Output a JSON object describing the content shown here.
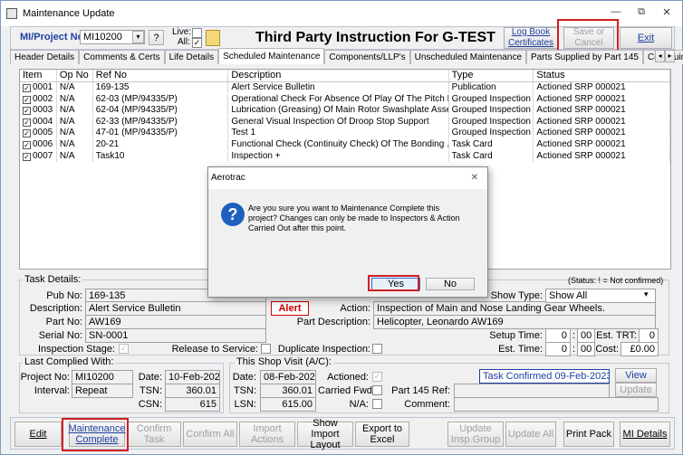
{
  "window": {
    "title": "Maintenance Update",
    "min": "—",
    "restore": "⧉",
    "close": "✕"
  },
  "top": {
    "project_label": "MI/Project No:",
    "project_value": "MI10200",
    "help": "?",
    "live_label": "Live:",
    "all_label": "All:",
    "instruction_title": "Third Party Instruction For G-TEST",
    "logbook": "Log Book Certificates",
    "save_cancel": "Save or Cancel",
    "exit": "Exit"
  },
  "tabs": [
    "Header Details",
    "Comments & Certs",
    "Life Details",
    "Scheduled Maintenance",
    "Components/LLP's",
    "Unscheduled Maintenance",
    "Parts Supplied by Part 145",
    "Continuing Airworthiness"
  ],
  "tab_arrows": {
    "left": "◂",
    "right": "▸"
  },
  "grid": {
    "headers": [
      "Item",
      "Op No",
      "Ref No",
      "Description",
      "Type",
      "Status"
    ],
    "rows": [
      {
        "item": "0001",
        "op": "N/A",
        "ref": "169-135",
        "desc": "Alert Service Bulletin",
        "type": "Publication",
        "status": "Actioned SRP 000021"
      },
      {
        "item": "0002",
        "op": "N/A",
        "ref": "62-03 (MP/94335/P)",
        "desc": "Operational Check For Absence Of Play Of The Pitch Li...",
        "type": "Grouped Inspection",
        "status": "Actioned SRP 000021"
      },
      {
        "item": "0003",
        "op": "N/A",
        "ref": "62-04 (MP/94335/P)",
        "desc": "Lubrication (Greasing) Of Main Rotor Swashplate Asse...",
        "type": "Grouped Inspection",
        "status": "Actioned SRP 000021"
      },
      {
        "item": "0004",
        "op": "N/A",
        "ref": "62-33 (MP/94335/P)",
        "desc": "General Visual Inspection Of Droop Stop Support",
        "type": "Grouped Inspection",
        "status": "Actioned SRP 000021"
      },
      {
        "item": "0005",
        "op": "N/A",
        "ref": "47-01 (MP/94335/P)",
        "desc": "Test 1",
        "type": "Grouped Inspection",
        "status": "Actioned SRP 000021"
      },
      {
        "item": "0006",
        "op": "N/A",
        "ref": "20-21",
        "desc": "Functional Check (Continuity Check)  Of The Bonding ...",
        "type": "Task Card",
        "status": "Actioned SRP 000021"
      },
      {
        "item": "0007",
        "op": "N/A",
        "ref": "Task10",
        "desc": "Inspection +",
        "type": "Task Card",
        "status": "Actioned SRP 000021"
      }
    ]
  },
  "task": {
    "title": "Task Details:",
    "status_note": "(Status: ! = Not confirmed)",
    "pub_label": "Pub No:",
    "pub": "169-135",
    "desc_label": "Description:",
    "desc": "Alert Service Bulletin",
    "alert": "Alert",
    "action_label": "Action:",
    "action": "Inspection of Main and Nose Landing Gear Wheels.",
    "show_type_label": "Show Type:",
    "show_type": "Show All",
    "part_label": "Part No:",
    "part": "AW169",
    "part_desc_label": "Part Description:",
    "part_desc": "Helicopter, Leonardo AW169",
    "serial_label": "Serial No:",
    "serial": "SN-0001",
    "setup_label": "Setup Time:",
    "setup_h": "0",
    "setup_m": "00",
    "est_trt_label": "Est. TRT:",
    "est_trt": "0",
    "insp_stage_label": "Inspection Stage:",
    "rel_service_label": "Release to Service:",
    "dup_insp_label": "Duplicate Inspection:",
    "est_time_label": "Est. Time:",
    "est_h": "0",
    "est_m": "00",
    "cost_label": "Cost:",
    "cost": "£0.00"
  },
  "last": {
    "title": "Last Complied With:",
    "project_label": "Project No:",
    "project": "MI10200",
    "date_label": "Date:",
    "date": "10-Feb-2023",
    "interval_label": "Interval:",
    "interval": "Repeat",
    "tsn_label": "TSN:",
    "tsn": "360.01",
    "csn_label": "CSN:",
    "csn": "615"
  },
  "shop": {
    "title": "This Shop Visit (A/C):",
    "date_label": "Date:",
    "date": "08-Feb-2023",
    "tsn_label": "TSN:",
    "tsn": "360.01",
    "lsn_label": "LSN:",
    "lsn": "615.00",
    "actioned_label": "Actioned:",
    "carried_label": "Carried Fwd:",
    "na_label": "N/A:",
    "part145_label": "Part 145 Ref:",
    "comment_label": "Comment:",
    "confirmed": "Task Confirmed 09-Feb-2023",
    "view": "View",
    "update": "Update"
  },
  "dialog": {
    "title": "Aerotrac",
    "close": "✕",
    "icon": "?",
    "message": "Are you sure you want to Maintenance Complete this project? Changes can only be made to Inspectors & Action Carried Out after this point.",
    "yes": "Yes",
    "no": "No"
  },
  "bottom": {
    "edit": "Edit",
    "maint_complete": "Maintenance Complete",
    "confirm_task": "Confirm Task",
    "confirm_all": "Confirm All",
    "import_actions": "Import Actions",
    "show_import": "Show Import Layout",
    "export": "Export to Excel",
    "update_insp": "Update Insp.Group",
    "update_all": "Update All",
    "print_pack": "Print Pack",
    "mi_details": "MI Details"
  },
  "colors": {
    "alert": "#d00000",
    "highlight": "#d02020",
    "accent": "#1f3fa0"
  }
}
